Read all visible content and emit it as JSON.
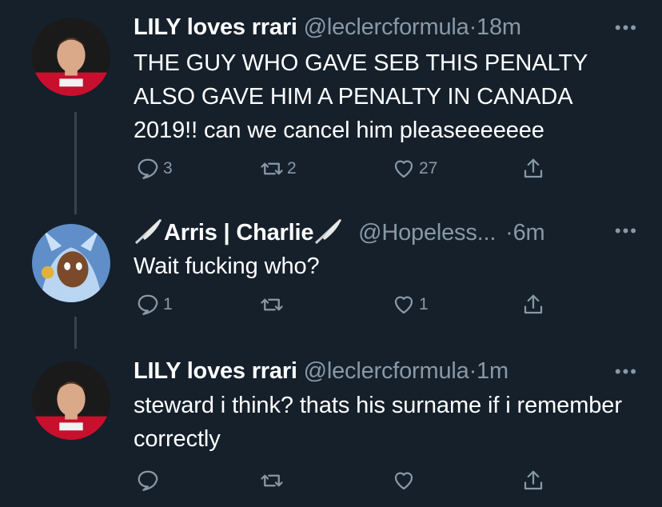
{
  "tweets": [
    {
      "name": "LILY loves rrari",
      "handle": "@leclercformula",
      "dot": "·",
      "time": "18m",
      "more": "•••",
      "text": "THE GUY WHO GAVE SEB THIS PENALTY ALSO GAVE HIM A PENALTY IN CANADA 2019!! can we cancel him pleaseeeeeee",
      "replies": "3",
      "retweets": "2",
      "likes": "27"
    },
    {
      "name": "Arris | Charlie",
      "handle": "@Hopeless...",
      "dot": "·",
      "time": "6m",
      "more": "•••",
      "text": "Wait fucking who?",
      "replies": "1",
      "retweets": "",
      "likes": "1"
    },
    {
      "name": "LILY loves rrari",
      "handle": "@leclercformula",
      "dot": "·",
      "time": "1m",
      "more": "•••",
      "text": "steward i think? thats his surname if i remember correctly",
      "replies": "",
      "retweets": "",
      "likes": ""
    }
  ],
  "icons": {
    "reply": "reply-icon",
    "retweet": "retweet-icon",
    "like": "heart-icon",
    "share": "share-icon",
    "quill": "quill-pen-icon"
  },
  "colors": {
    "background": "#15202b",
    "muted": "#8899a6",
    "thread_line": "#38444d"
  }
}
